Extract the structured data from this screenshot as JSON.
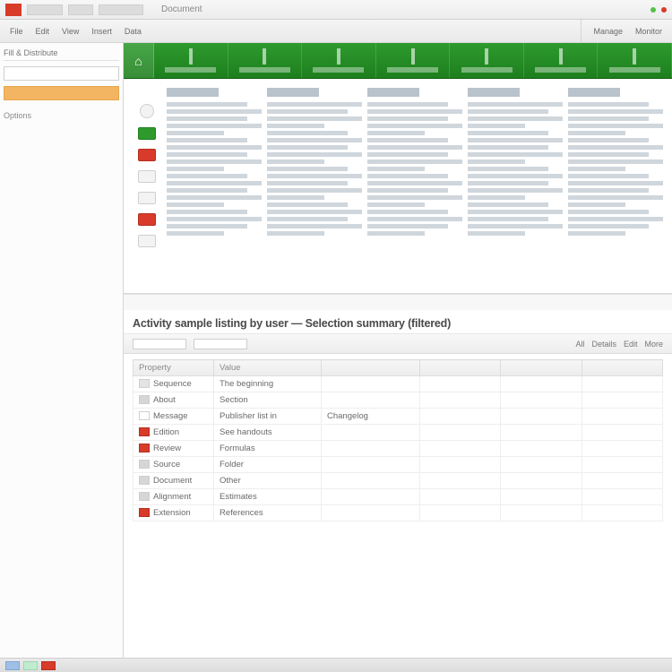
{
  "titlebar": {
    "text_blocks": [
      "",
      "",
      ""
    ],
    "doc_label": "Document"
  },
  "menubar": {
    "items": [
      "File",
      "Edit",
      "View",
      "Insert",
      "Data"
    ],
    "right_items": [
      "Manage",
      "Monitor"
    ]
  },
  "sidebar": {
    "title": "Fill & Distribute",
    "field1": "",
    "selected": "",
    "item": "Options"
  },
  "ribbon_cols": 7,
  "panel": {
    "heading": "Activity sample listing by user — Selection summary (filtered)",
    "toolbar_left": "",
    "toolbar_right_items": [
      "All",
      "Details",
      "Edit",
      "More"
    ]
  },
  "table": {
    "headers": [
      "Property",
      "Value",
      "",
      "",
      "",
      ""
    ],
    "rows": [
      {
        "sw": "grey",
        "c0": "Sequence",
        "c1": "The beginning"
      },
      {
        "sw": "grey",
        "c0": "About",
        "c1": "Section"
      },
      {
        "sw": "white",
        "c0": "Message",
        "c1": "Publisher list in",
        "c2": "Changelog"
      },
      {
        "sw": "red",
        "c0": "Edition",
        "c1": "See handouts"
      },
      {
        "sw": "red",
        "c0": "Review",
        "c1": "Formulas"
      },
      {
        "sw": "grey",
        "c0": "Source",
        "c1": "Folder"
      },
      {
        "sw": "grey",
        "c0": "Document",
        "c1": "Other"
      },
      {
        "sw": "grey",
        "c0": "Alignment",
        "c1": "Estimates"
      },
      {
        "sw": "red",
        "c0": "Extension",
        "c1": "References"
      }
    ]
  }
}
